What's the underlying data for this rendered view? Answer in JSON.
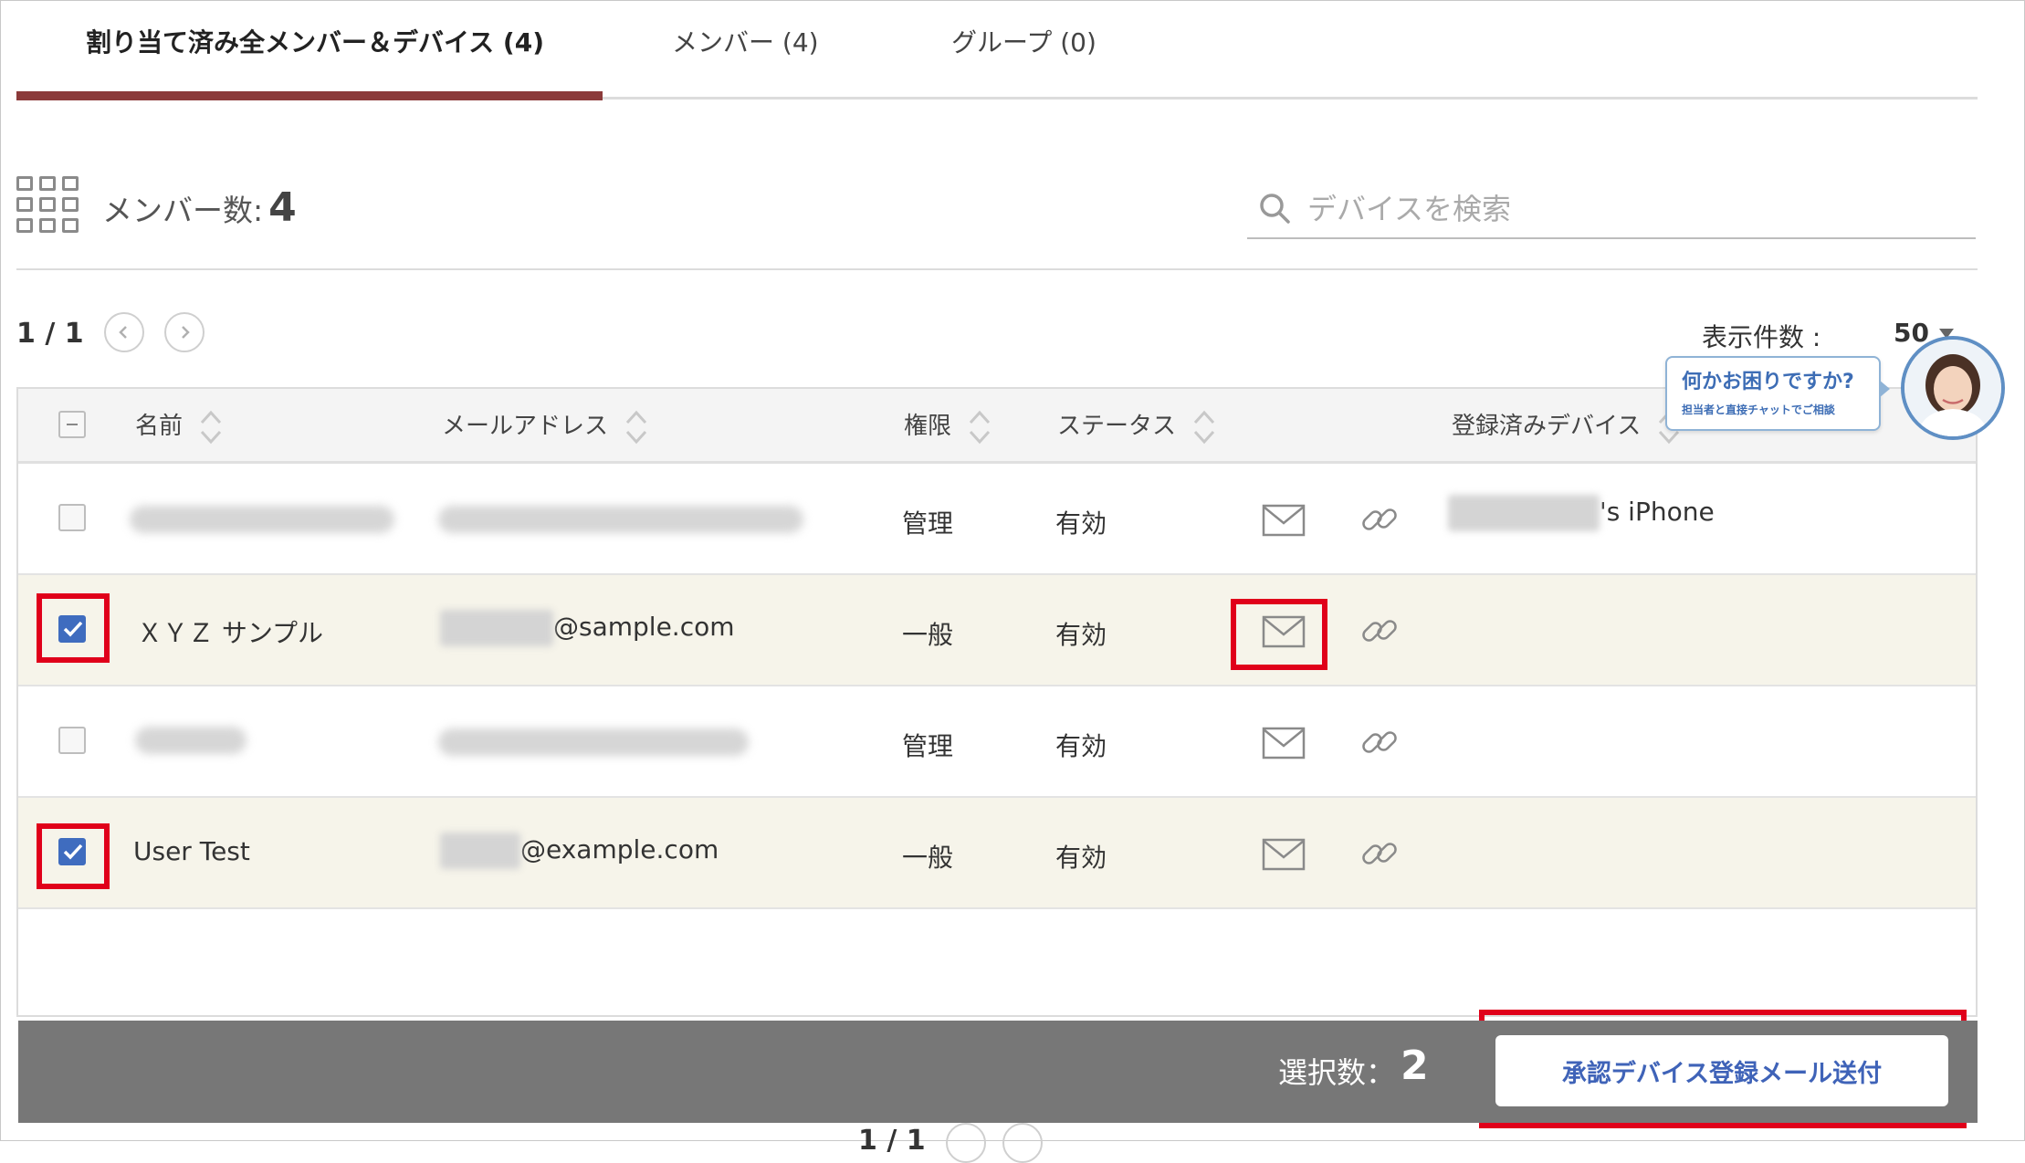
{
  "tabs": [
    {
      "label": "割り当て済み全メンバー＆デバイス (4)",
      "active": true
    },
    {
      "label": "メンバー (4)",
      "active": false
    },
    {
      "label": "グループ (0)",
      "active": false
    }
  ],
  "summary": {
    "member_count_label": "メンバー数:",
    "member_count": "4"
  },
  "search": {
    "placeholder": "デバイスを検索"
  },
  "pager": {
    "page": "1 / 1",
    "per_page_label": "表示件数 :",
    "per_page_value": "50"
  },
  "table": {
    "headers": {
      "name": "名前",
      "email": "メールアドレス",
      "role": "権限",
      "status": "ステータス",
      "devices": "登録済みデバイス"
    },
    "rows": [
      {
        "name": "",
        "email": "",
        "role": "管理",
        "status": "有効",
        "device": "'s iPhone",
        "checked": false
      },
      {
        "name": "ＸＹＺ サンプル",
        "email": "@sample.com",
        "role": "一般",
        "status": "有効",
        "device": "",
        "checked": true
      },
      {
        "name": "",
        "email": "",
        "role": "管理",
        "status": "有効",
        "device": "",
        "checked": false
      },
      {
        "name": "User Test",
        "email": "@example.com",
        "role": "一般",
        "status": "有効",
        "device": "",
        "checked": true
      }
    ]
  },
  "footer": {
    "selected_label": "選択数：",
    "selected_count": "2",
    "send_button": "承認デバイス登録メール送付",
    "page": "1 / 1"
  },
  "chat": {
    "title": "何かお困りですか?",
    "subtitle": "担当者と直接チャットでご相談"
  },
  "colors": {
    "tab_active": "#8b3a3a",
    "checkbox_checked": "#3f6cbf",
    "highlight": "#e0001a",
    "footer_bg": "#777777",
    "button_text": "#3f63b8"
  }
}
